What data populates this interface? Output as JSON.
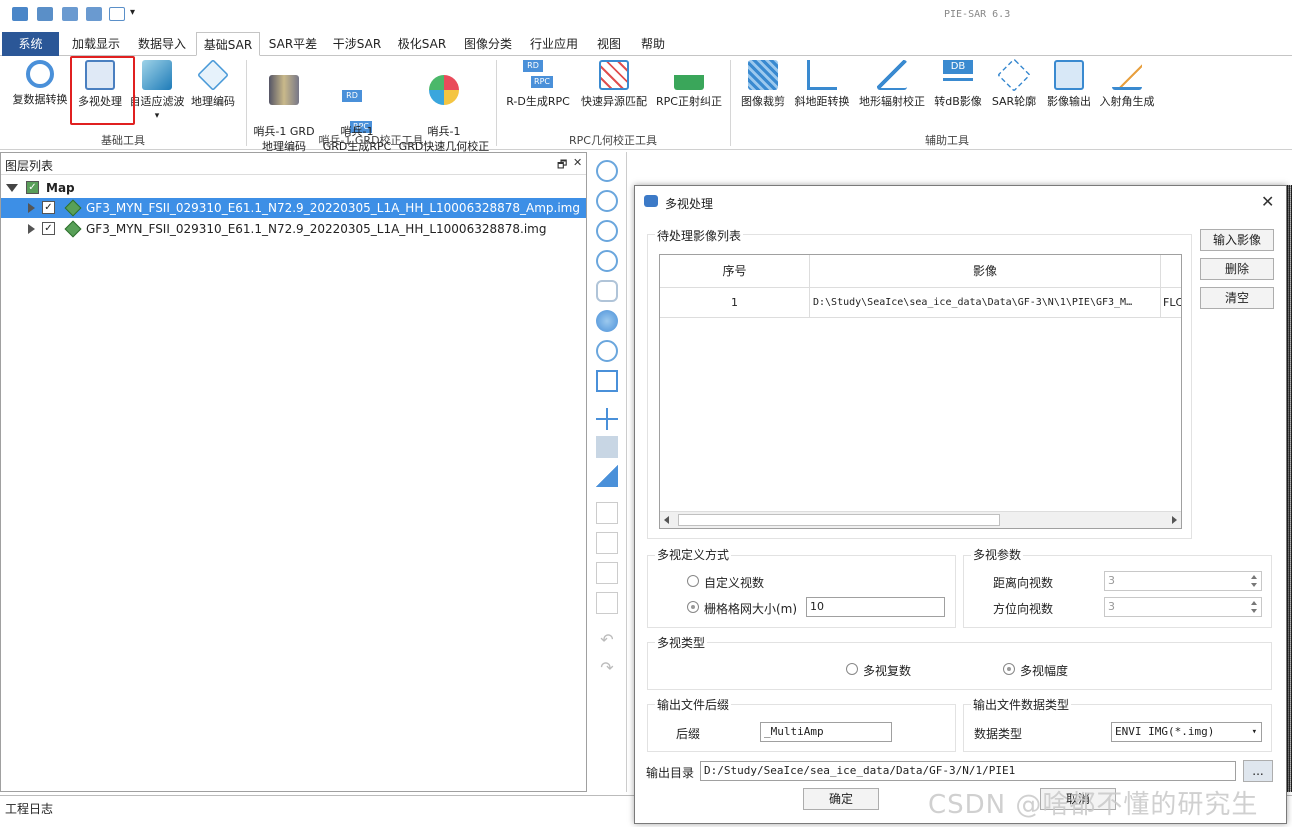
{
  "app": {
    "title": "PIE-SAR 6.3"
  },
  "menu": {
    "tabs": [
      "系统",
      "加载显示",
      "数据导入",
      "基础SAR",
      "SAR平差",
      "干涉SAR",
      "极化SAR",
      "图像分类",
      "行业应用",
      "视图",
      "帮助"
    ],
    "active": "基础SAR"
  },
  "ribbon": {
    "groups": [
      {
        "label": "基础工具",
        "buttons": [
          "复数据转换",
          "多视处理",
          "自适应滤波",
          "地理编码"
        ]
      },
      {
        "label": "哨兵-1 GRD校正工具",
        "buttons": [
          "哨兵-1 GRD\n地理编码",
          "哨兵-1\nGRD生成RPC",
          "哨兵-1\nGRD快速几何校正"
        ]
      },
      {
        "label": "RPC几何校正工具",
        "buttons": [
          "R-D生成RPC",
          "快速异源匹配",
          "RPC正射纠正"
        ]
      },
      {
        "label": "辅助工具",
        "buttons": [
          "图像裁剪",
          "斜地距转换",
          "地形辐射校正",
          "转dB影像",
          "SAR轮廓",
          "影像输出",
          "入射角生成"
        ]
      }
    ],
    "icon_labels": {
      "rd": "RD",
      "rpc": "RPC",
      "db": "DB"
    }
  },
  "layer_panel": {
    "title": "图层列表",
    "root": "Map",
    "layers": [
      {
        "name": "GF3_MYN_FSII_029310_E61.1_N72.9_20220305_L1A_HH_L10006328878_Amp.img",
        "checked": true,
        "selected": true
      },
      {
        "name": "GF3_MYN_FSII_029310_E61.1_N72.9_20220305_L1A_HH_L10006328878.img",
        "checked": true,
        "selected": false
      }
    ]
  },
  "log": {
    "title": "工程日志"
  },
  "dialog": {
    "title": "多视处理",
    "list_group": "待处理影像列表",
    "table": {
      "headers": [
        "序号",
        "影像"
      ],
      "rows": [
        {
          "index": "1",
          "path": "D:\\Study\\SeaIce\\sea_ice_data\\Data\\GF-3\\N\\1\\PIE\\GF3_M…",
          "extra": "FLC"
        }
      ]
    },
    "buttons": {
      "input": "输入影像",
      "delete": "删除",
      "clear": "清空",
      "ok": "确定",
      "cancel": "取消",
      "browse": "..."
    },
    "look_def": {
      "group": "多视定义方式",
      "options": [
        "自定义视数",
        "栅格格网大小(m)"
      ],
      "selected": 1,
      "grid_size": "10"
    },
    "look_params": {
      "group": "多视参数",
      "range_label": "距离向视数",
      "range_value": "3",
      "azimuth_label": "方位向视数",
      "azimuth_value": "3"
    },
    "look_type": {
      "group": "多视类型",
      "options": [
        "多视复数",
        "多视幅度"
      ],
      "selected": 1
    },
    "suffix": {
      "group": "输出文件后缀",
      "label": "后缀",
      "value": "_MultiAmp"
    },
    "datatype": {
      "group": "输出文件数据类型",
      "label": "数据类型",
      "value": "ENVI IMG(*.img)"
    },
    "output_dir": {
      "label": "输出目录",
      "value": "D:/Study/SeaIce/sea_ice_data/Data/GF-3/N/1/PIE1"
    }
  },
  "watermark": "CSDN @啥都不懂的研究生",
  "colors": {
    "system_tab": "#2b5797",
    "selection": "#3d8fe6",
    "highlight": "#e02020"
  }
}
